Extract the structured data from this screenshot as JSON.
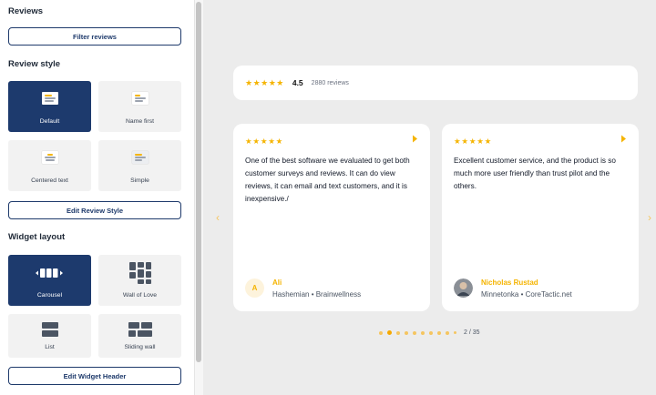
{
  "sidebar": {
    "reviews_title": "Reviews",
    "filter_button": "Filter reviews",
    "review_style_title": "Review style",
    "styles": [
      {
        "label": "Default",
        "active": true
      },
      {
        "label": "Name first",
        "active": false
      },
      {
        "label": "Centered text",
        "active": false
      },
      {
        "label": "Simple",
        "active": false
      }
    ],
    "edit_review_style": "Edit Review Style",
    "widget_layout_title": "Widget layout",
    "layouts": [
      {
        "label": "Carousel",
        "active": true
      },
      {
        "label": "Wall of Love",
        "active": false
      },
      {
        "label": "List",
        "active": false
      },
      {
        "label": "Sliding wall",
        "active": false
      }
    ],
    "edit_widget_header": "Edit Widget Header"
  },
  "summary": {
    "stars": "★★★★★",
    "rating": "4.5",
    "count": "2880 reviews"
  },
  "reviews": [
    {
      "stars": "★★★★★",
      "text": "One of the best software we evaluated to get both customer surveys and reviews. It can do view reviews, it can email and text customers, and it is inexpensive./",
      "initial": "A",
      "name": "Ali",
      "meta": "Hashemian • Brainwellness"
    },
    {
      "stars": "★★★★★",
      "text": "Excellent customer service, and the product is so much more user friendly than trust pilot and the others.",
      "name": "Nicholas Rustad",
      "meta": "Minnetonka • CoreTactic.net"
    }
  ],
  "pagination": {
    "text": "2 / 35",
    "current": 2,
    "total": 35
  },
  "icons": {
    "prev": "chevron-left-icon",
    "next": "chevron-right-icon",
    "source": "source-logo-icon"
  },
  "colors": {
    "accent": "#1d3a6d",
    "star": "#f5b400",
    "background": "#ececec"
  }
}
